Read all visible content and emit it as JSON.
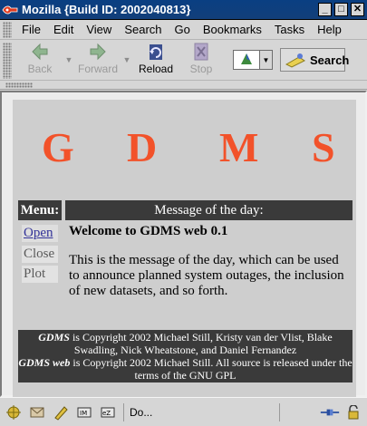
{
  "window": {
    "title": "Mozilla {Build ID: 2002040813}",
    "minimize_glyph": "_",
    "maximize_glyph": "□",
    "close_glyph": "✕"
  },
  "menu": {
    "items": [
      "File",
      "Edit",
      "View",
      "Search",
      "Go",
      "Bookmarks",
      "Tasks",
      "Help"
    ]
  },
  "toolbar": {
    "back_label": "Back",
    "forward_label": "Forward",
    "reload_label": "Reload",
    "stop_label": "Stop",
    "search_label": "Search"
  },
  "page": {
    "logo_letters": [
      "G",
      "D",
      "M",
      "S"
    ],
    "menu_header": "Menu:",
    "motd_header": "Message of the day:",
    "side_links": [
      "Open",
      "Close",
      "Plot"
    ],
    "motd_title": "Welcome to GDMS web 0.1",
    "motd_body": "This is the message of the day, which can be used to announce planned system outages, the inclusion of new datasets, and so forth.",
    "footer_line1_em": "GDMS",
    "footer_line1": " is Copyright 2002 Michael Still, Kristy van der Vlist, Blake Swadling, Nick Wheatstone, and Daniel Fernandez",
    "footer_line2_em": "GDMS web",
    "footer_line2": " is Copyright 2002 Michael Still. All source is released under the terms of the GNU GPL"
  },
  "status": {
    "text": "Do..."
  },
  "colors": {
    "logo": "#f2522a",
    "header_bg": "#3a3a3a",
    "titlebar": "#0a3f82"
  }
}
